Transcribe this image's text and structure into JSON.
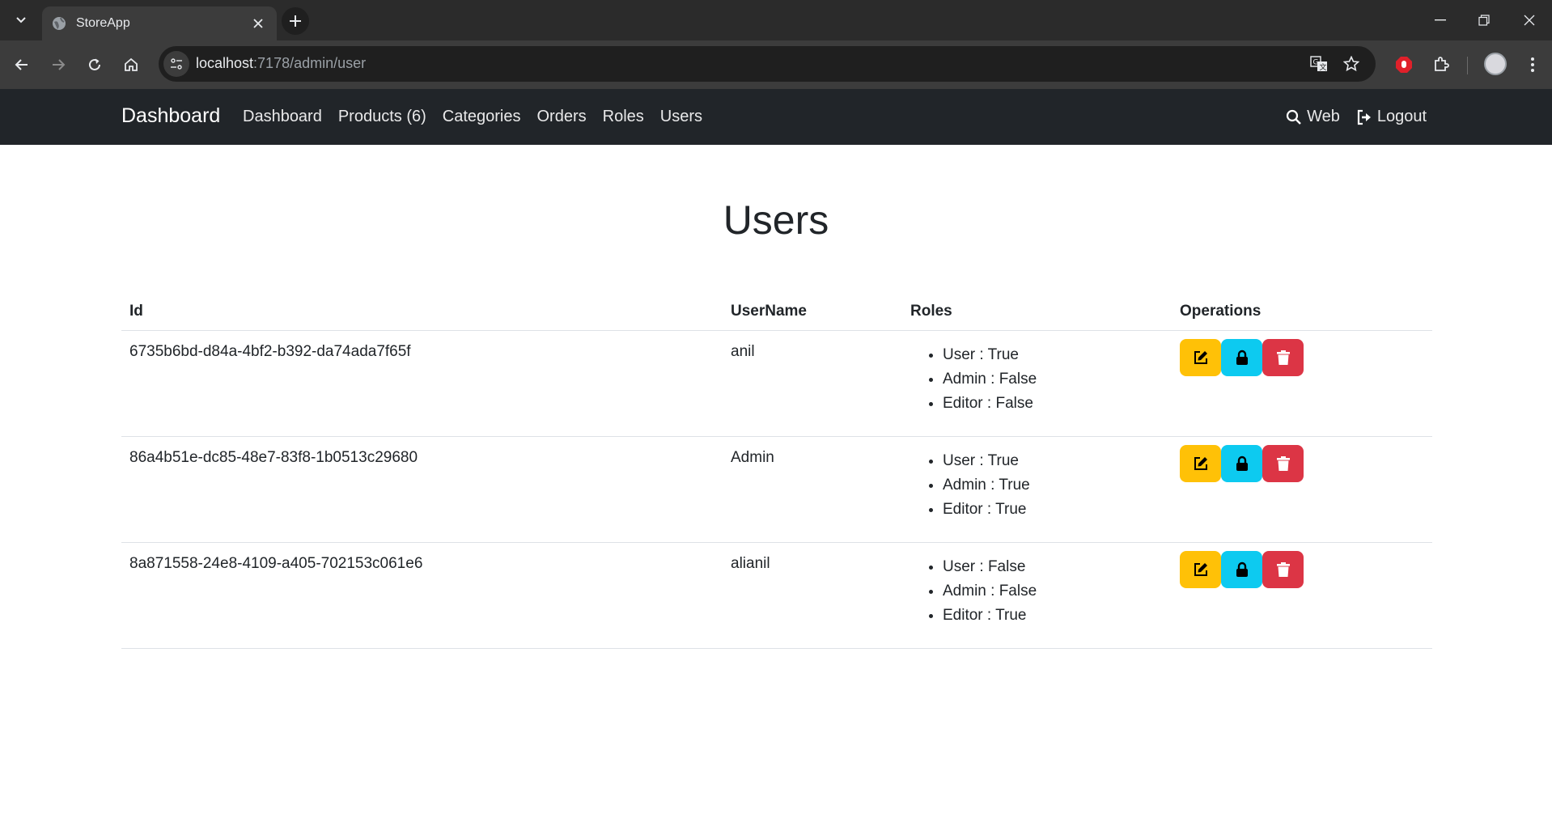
{
  "browser": {
    "tab_title": "StoreApp",
    "url_host": "localhost",
    "url_path": ":7178/admin/user"
  },
  "navbar": {
    "brand": "Dashboard",
    "links": [
      "Dashboard",
      "Products (6)",
      "Categories",
      "Orders",
      "Roles",
      "Users"
    ],
    "search_label": "Web",
    "logout_label": "Logout"
  },
  "page": {
    "title": "Users"
  },
  "table": {
    "headers": [
      "Id",
      "UserName",
      "Roles",
      "Operations"
    ],
    "rows": [
      {
        "id": "6735b6bd-d84a-4bf2-b392-da74ada7f65f",
        "username": "anil",
        "roles": [
          "User : True",
          "Admin : False",
          "Editor : False"
        ]
      },
      {
        "id": "86a4b51e-dc85-48e7-83f8-1b0513c29680",
        "username": "Admin",
        "roles": [
          "User : True",
          "Admin : True",
          "Editor : True"
        ]
      },
      {
        "id": "8a871558-24e8-4109-a405-702153c061e6",
        "username": "alianil",
        "roles": [
          "User : False",
          "Admin : False",
          "Editor : True"
        ]
      }
    ]
  },
  "colors": {
    "edit": "#ffc107",
    "password": "#0dcaf0",
    "delete": "#dc3545",
    "navbar": "#212529"
  }
}
